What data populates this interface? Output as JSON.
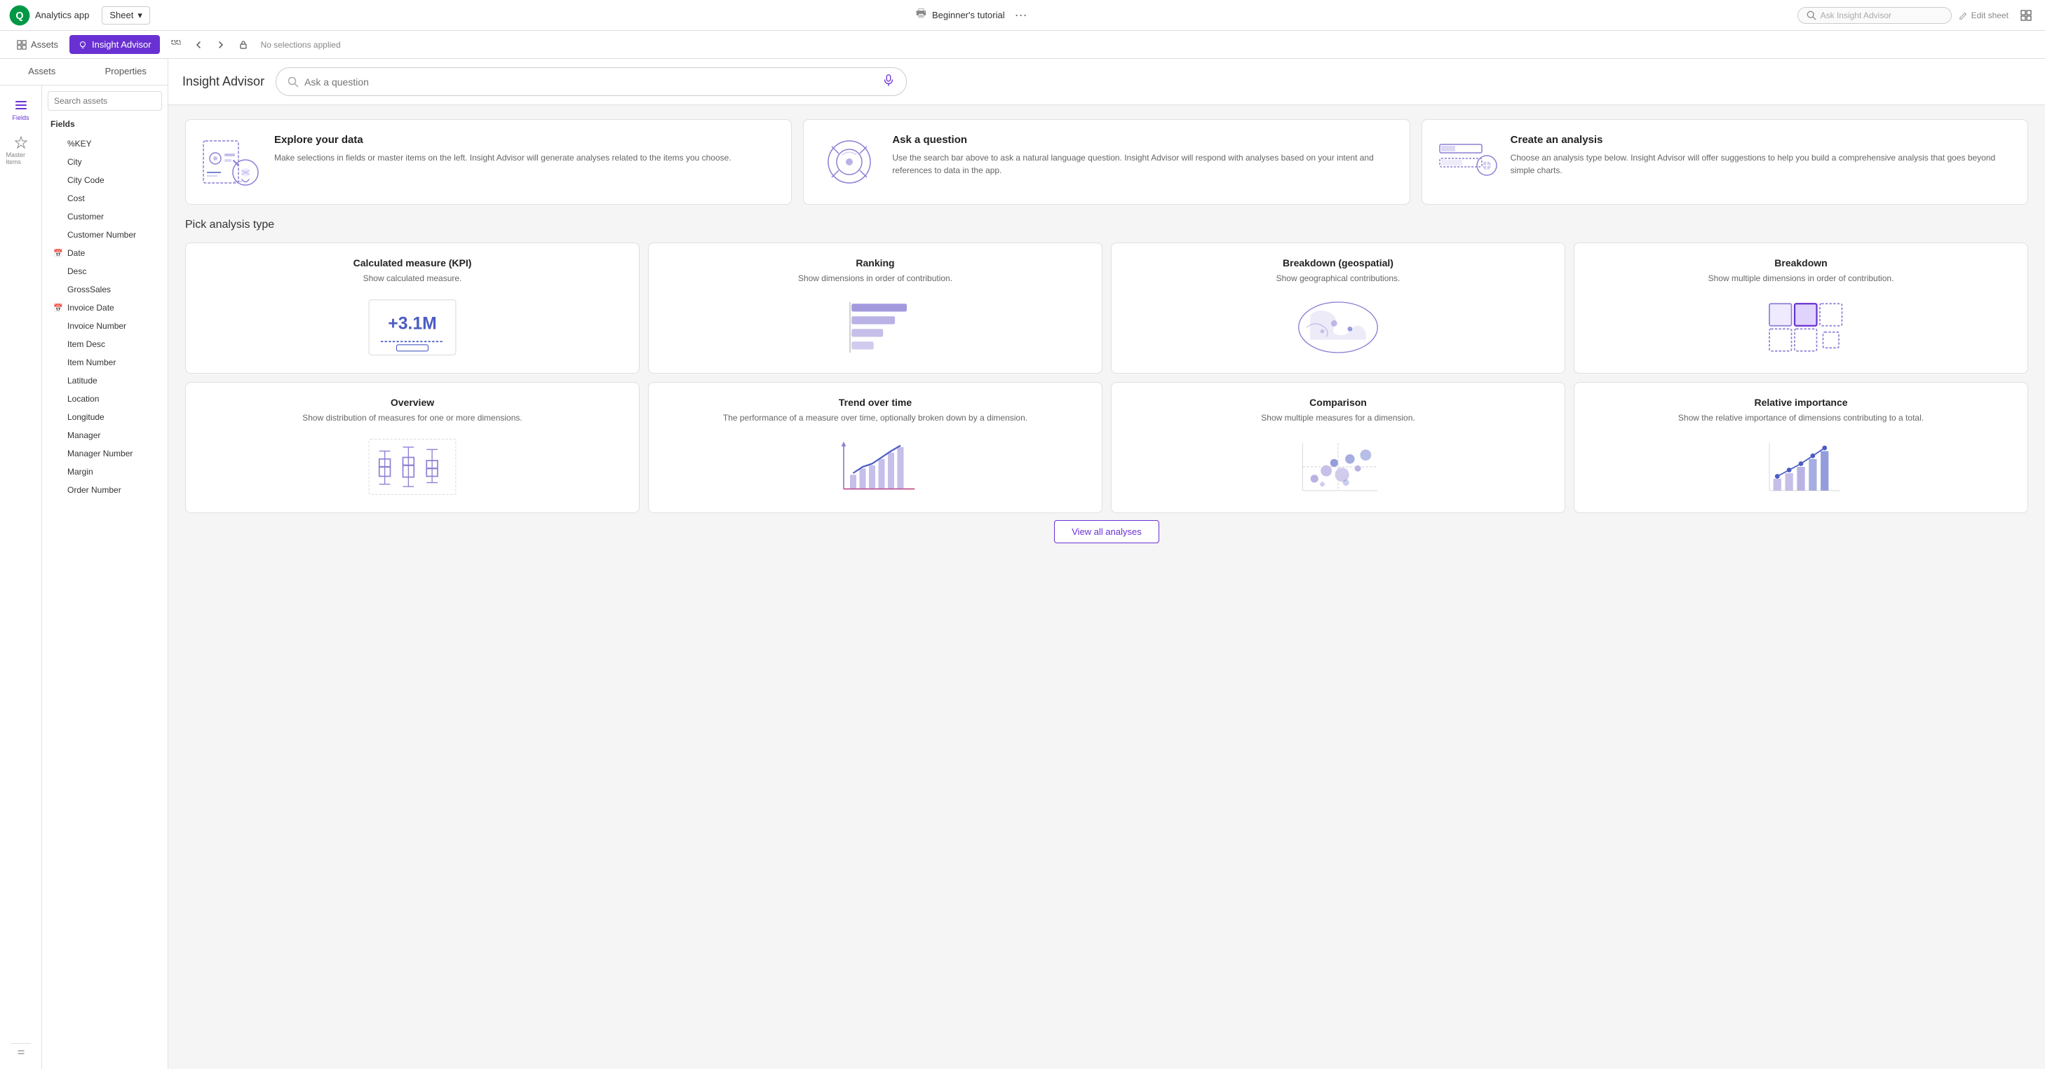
{
  "app": {
    "logo_text": "Qlik",
    "app_name": "Analytics app",
    "sheet_label": "Sheet",
    "tutorial_label": "Beginner's tutorial",
    "ask_insight_label": "Ask Insight Advisor",
    "edit_sheet_label": "Edit sheet",
    "no_selections": "No selections applied"
  },
  "nav": {
    "assets_label": "Assets",
    "insight_label": "Insight Advisor"
  },
  "sidebar": {
    "fields_label": "Fields",
    "master_items_label": "Master items"
  },
  "fields_panel": {
    "search_placeholder": "Search assets",
    "section_title": "Fields",
    "items": [
      {
        "name": "%KEY",
        "type": "text"
      },
      {
        "name": "City",
        "type": "text"
      },
      {
        "name": "City Code",
        "type": "text"
      },
      {
        "name": "Cost",
        "type": "text"
      },
      {
        "name": "Customer",
        "type": "text"
      },
      {
        "name": "Customer Number",
        "type": "text"
      },
      {
        "name": "Date",
        "type": "calendar"
      },
      {
        "name": "Desc",
        "type": "text"
      },
      {
        "name": "GrossSales",
        "type": "text"
      },
      {
        "name": "Invoice Date",
        "type": "calendar"
      },
      {
        "name": "Invoice Number",
        "type": "text"
      },
      {
        "name": "Item Desc",
        "type": "text"
      },
      {
        "name": "Item Number",
        "type": "text"
      },
      {
        "name": "Latitude",
        "type": "text"
      },
      {
        "name": "Location",
        "type": "text"
      },
      {
        "name": "Longitude",
        "type": "text"
      },
      {
        "name": "Manager",
        "type": "text"
      },
      {
        "name": "Manager Number",
        "type": "text"
      },
      {
        "name": "Margin",
        "type": "text"
      },
      {
        "name": "Order Number",
        "type": "text"
      }
    ]
  },
  "ia": {
    "title": "Insight Advisor",
    "search_placeholder": "Ask a question",
    "cards": [
      {
        "id": "explore",
        "title": "Explore your data",
        "desc": "Make selections in fields or master items on the left. Insight Advisor will generate analyses related to the items you choose."
      },
      {
        "id": "ask",
        "title": "Ask a question",
        "desc": "Use the search bar above to ask a natural language question. Insight Advisor will respond with analyses based on your intent and references to data in the app."
      },
      {
        "id": "create",
        "title": "Create an analysis",
        "desc": "Choose an analysis type below. Insight Advisor will offer suggestions to help you build a comprehensive analysis that goes beyond simple charts."
      }
    ],
    "pick_analysis_title": "Pick analysis type",
    "analyses": [
      {
        "id": "kpi",
        "title": "Calculated measure (KPI)",
        "desc": "Show calculated measure.",
        "kpi_value": "+3.1M"
      },
      {
        "id": "ranking",
        "title": "Ranking",
        "desc": "Show dimensions in order of contribution."
      },
      {
        "id": "geo",
        "title": "Breakdown (geospatial)",
        "desc": "Show geographical contributions."
      },
      {
        "id": "breakdown",
        "title": "Breakdown",
        "desc": "Show multiple dimensions in order of contribution."
      },
      {
        "id": "overview",
        "title": "Overview",
        "desc": "Show distribution of measures for one or more dimensions."
      },
      {
        "id": "trend",
        "title": "Trend over time",
        "desc": "The performance of a measure over time, optionally broken down by a dimension."
      },
      {
        "id": "comparison",
        "title": "Comparison",
        "desc": "Show multiple measures for a dimension."
      },
      {
        "id": "relative",
        "title": "Relative importance",
        "desc": "Show the relative importance of dimensions contributing to a total."
      }
    ],
    "view_all_label": "View all analyses"
  },
  "colors": {
    "brand": "#6931d3",
    "accent": "#5b4fcf",
    "light_purple": "#8b7fd4",
    "chart_blue": "#4b5cc4",
    "chart_pink": "#c44b8a"
  }
}
